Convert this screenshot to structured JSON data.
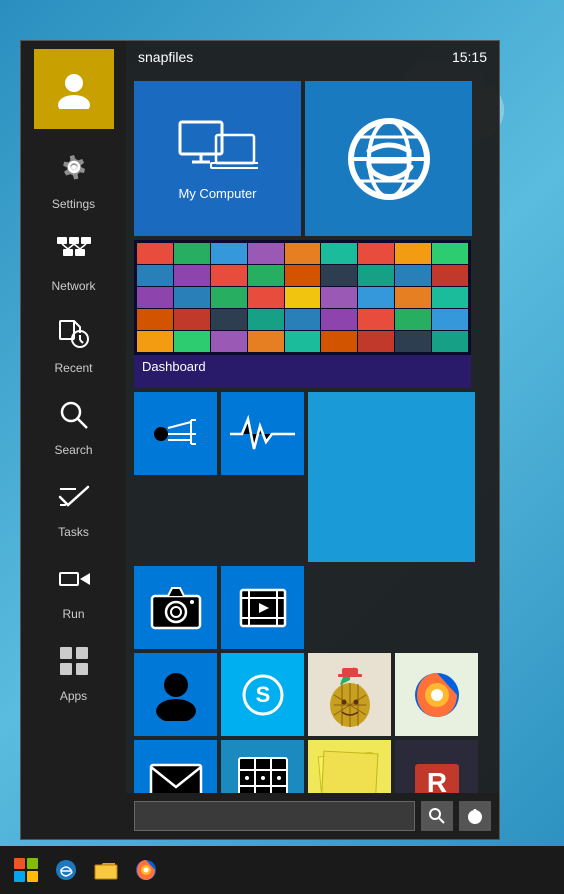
{
  "header": {
    "username": "snapfiles",
    "time": "15:15"
  },
  "sidebar": {
    "items": [
      {
        "id": "user",
        "label": "",
        "icon": "user"
      },
      {
        "id": "settings",
        "label": "Settings",
        "icon": "settings"
      },
      {
        "id": "network",
        "label": "Network",
        "icon": "network"
      },
      {
        "id": "recent",
        "label": "Recent",
        "icon": "recent"
      },
      {
        "id": "search",
        "label": "Search",
        "icon": "search"
      },
      {
        "id": "tasks",
        "label": "Tasks",
        "icon": "tasks"
      },
      {
        "id": "run",
        "label": "Run",
        "icon": "run"
      },
      {
        "id": "apps",
        "label": "Apps",
        "icon": "apps"
      }
    ]
  },
  "tiles": {
    "my_computer_label": "My Computer",
    "dashboard_label": "Dashboard",
    "search_placeholder": ""
  },
  "taskbar": {
    "items": [
      "windows-start",
      "internet-explorer",
      "file-explorer",
      "firefox"
    ]
  }
}
